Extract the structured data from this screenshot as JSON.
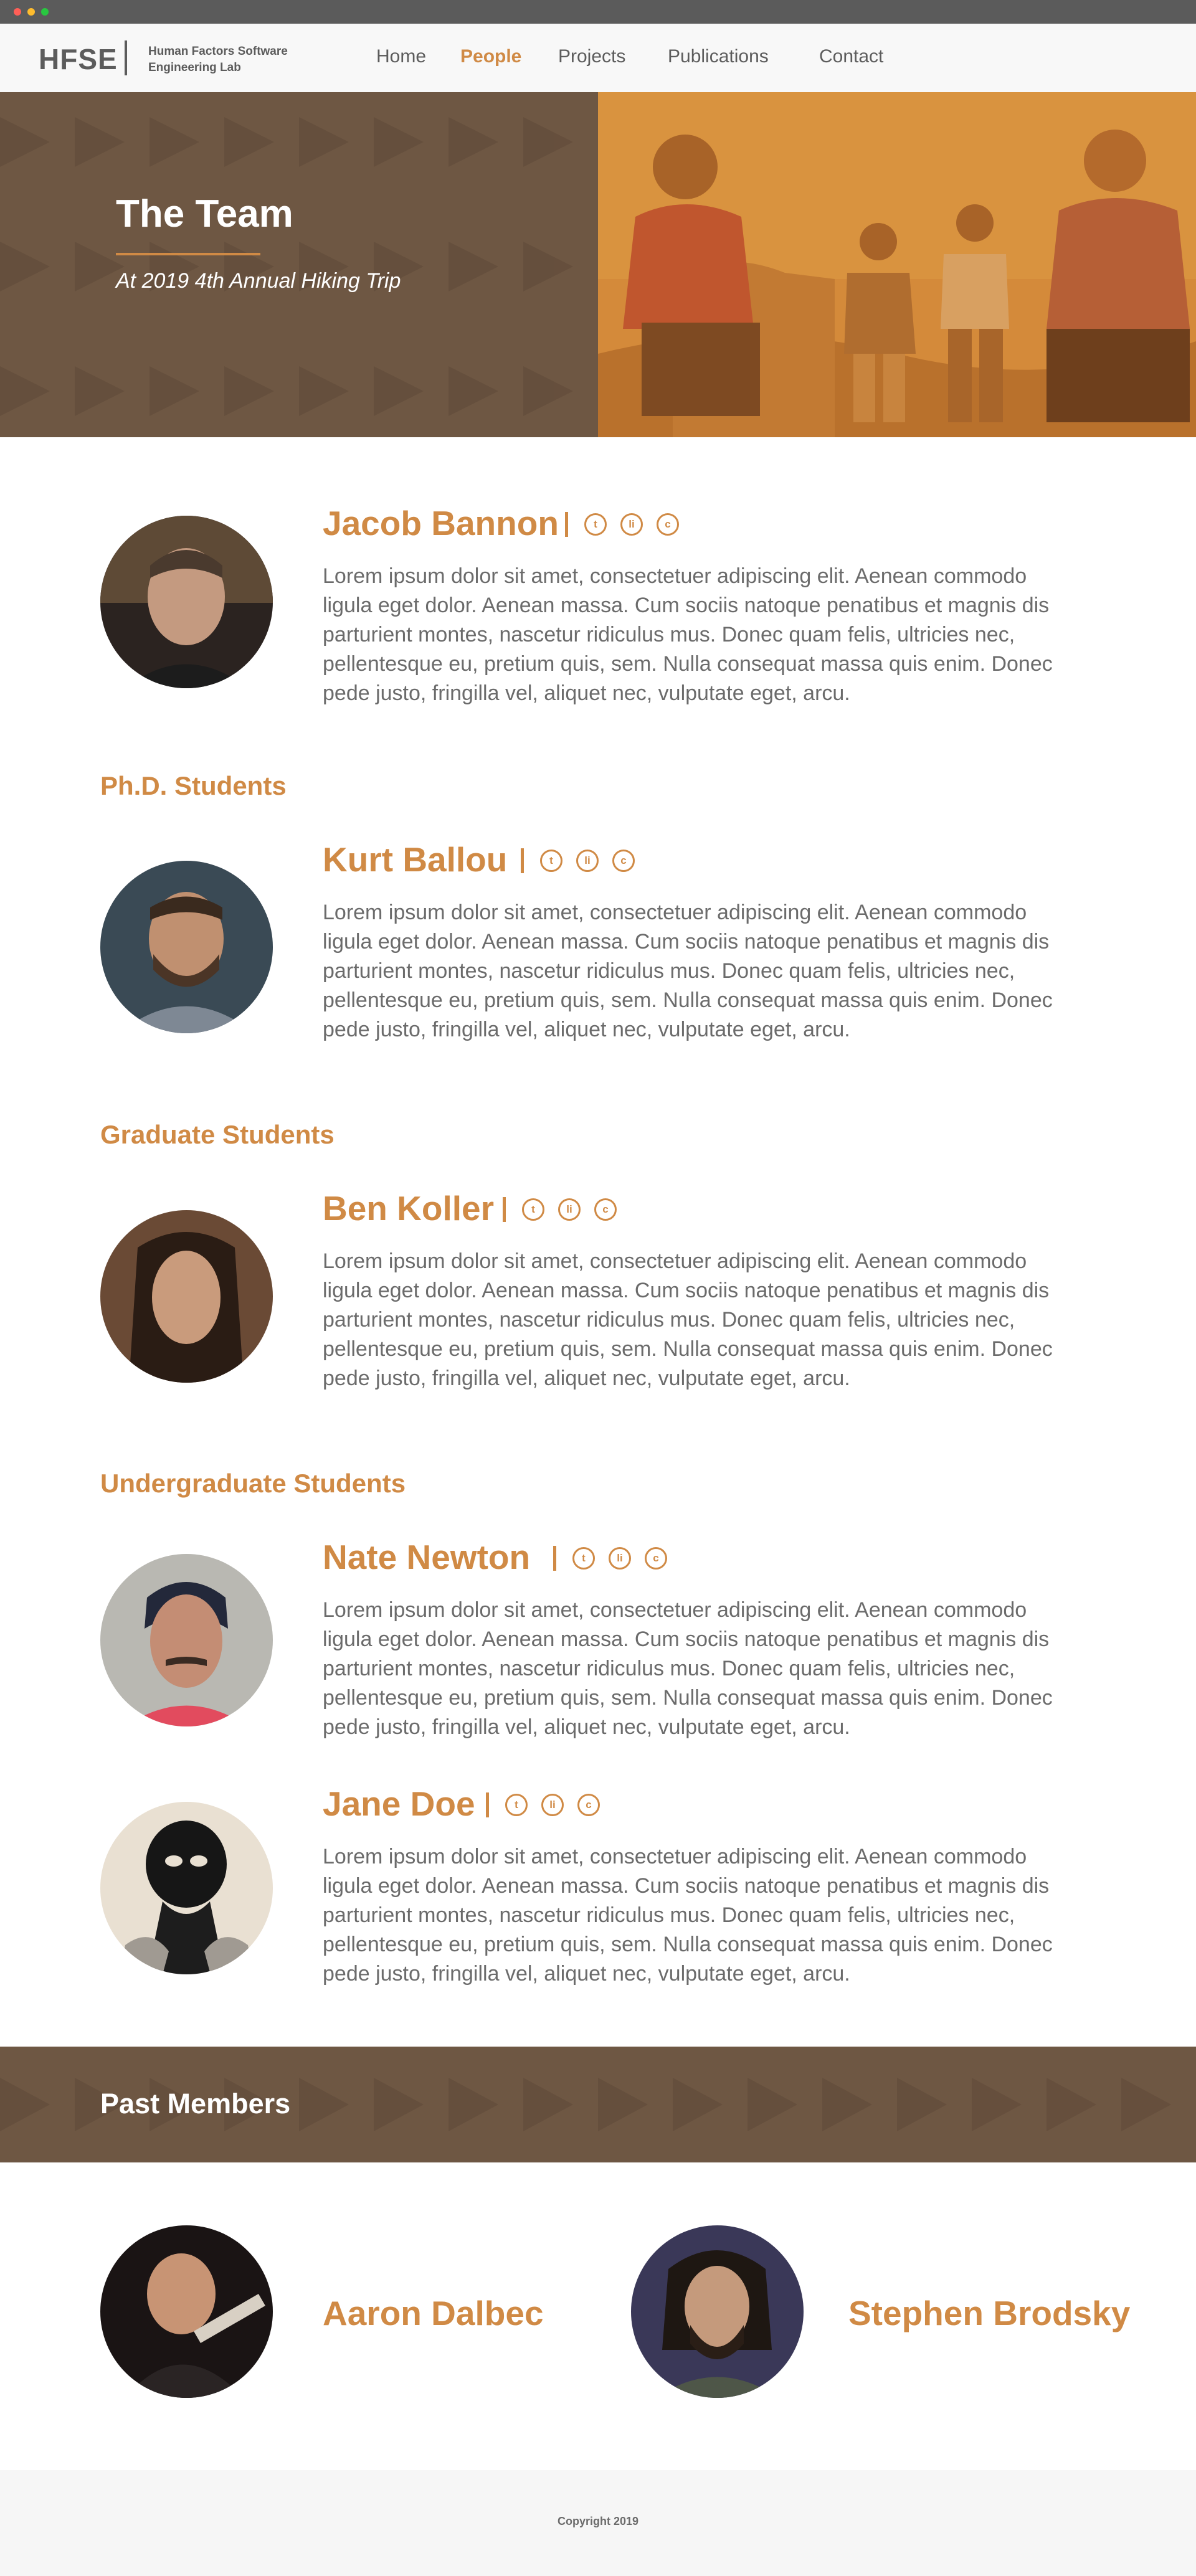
{
  "colors": {
    "accent": "#d08a45",
    "brown": "#6e5743",
    "text": "#6b6b6b",
    "chrome": "#5b5b5b"
  },
  "header": {
    "logo": "HFSE",
    "lab_name": "Human Factors Software Engineering Lab"
  },
  "nav": {
    "items": [
      {
        "label": "Home",
        "active": false
      },
      {
        "label": "People",
        "active": true
      },
      {
        "label": "Projects",
        "active": false
      },
      {
        "label": "Publications",
        "active": false
      },
      {
        "label": "Contact",
        "active": false
      }
    ]
  },
  "hero": {
    "title": "The Team",
    "subtitle": "At 2019 4th Annual Hiking Trip"
  },
  "lead": {
    "name": "Jacob Bannon",
    "bio": "Lorem ipsum dolor sit amet, consectetuer adipiscing elit. Aenean commodo ligula eget dolor. Aenean massa. Cum sociis natoque penatibus et magnis dis parturient montes, nascetur ridiculus mus. Donec quam felis, ultricies nec, pellentesque eu, pretium quis, sem. Nulla consequat massa quis enim. Donec pede justo, fringilla vel, aliquet nec, vulputate eget, arcu."
  },
  "social_icons": [
    "t",
    "li",
    "c"
  ],
  "sections": {
    "phd": {
      "heading": "Ph.D. Students",
      "members": [
        {
          "name": "Kurt Ballou",
          "bio": "Lorem ipsum dolor sit amet, consectetuer adipiscing elit. Aenean commodo ligula eget dolor. Aenean massa. Cum sociis natoque penatibus et magnis dis parturient montes, nascetur ridiculus mus. Donec quam felis, ultricies nec, pellentesque eu, pretium quis, sem. Nulla consequat massa quis enim. Donec pede justo, fringilla vel, aliquet nec, vulputate eget, arcu."
        }
      ]
    },
    "graduate": {
      "heading": "Graduate Students",
      "members": [
        {
          "name": "Ben Koller",
          "bio": "Lorem ipsum dolor sit amet, consectetuer adipiscing elit. Aenean commodo ligula eget dolor. Aenean massa. Cum sociis natoque penatibus et magnis dis parturient montes, nascetur ridiculus mus. Donec quam felis, ultricies nec, pellentesque eu, pretium quis, sem. Nulla consequat massa quis enim. Donec pede justo, fringilla vel, aliquet nec, vulputate eget, arcu."
        }
      ]
    },
    "undergraduate": {
      "heading": "Undergraduate Students",
      "members": [
        {
          "name": "Nate Newton",
          "bio": "Lorem ipsum dolor sit amet, consectetuer adipiscing elit. Aenean commodo ligula eget dolor. Aenean massa. Cum sociis natoque penatibus et magnis dis parturient montes, nascetur ridiculus mus. Donec quam felis, ultricies nec, pellentesque eu, pretium quis, sem. Nulla consequat massa quis enim. Donec pede justo, fringilla vel, aliquet nec, vulputate eget, arcu."
        },
        {
          "name": "Jane Doe",
          "bio": "Lorem ipsum dolor sit amet, consectetuer adipiscing elit. Aenean commodo ligula eget dolor. Aenean massa. Cum sociis natoque penatibus et magnis dis parturient montes, nascetur ridiculus mus. Donec quam felis, ultricies nec, pellentesque eu, pretium quis, sem. Nulla consequat massa quis enim. Donec pede justo, fringilla vel, aliquet nec, vulputate eget, arcu."
        }
      ]
    }
  },
  "past": {
    "title": "Past Members",
    "members": [
      {
        "name": "Aaron Dalbec"
      },
      {
        "name": "Stephen Brodsky"
      }
    ]
  },
  "footer": {
    "copyright": "Copyright 2019"
  }
}
